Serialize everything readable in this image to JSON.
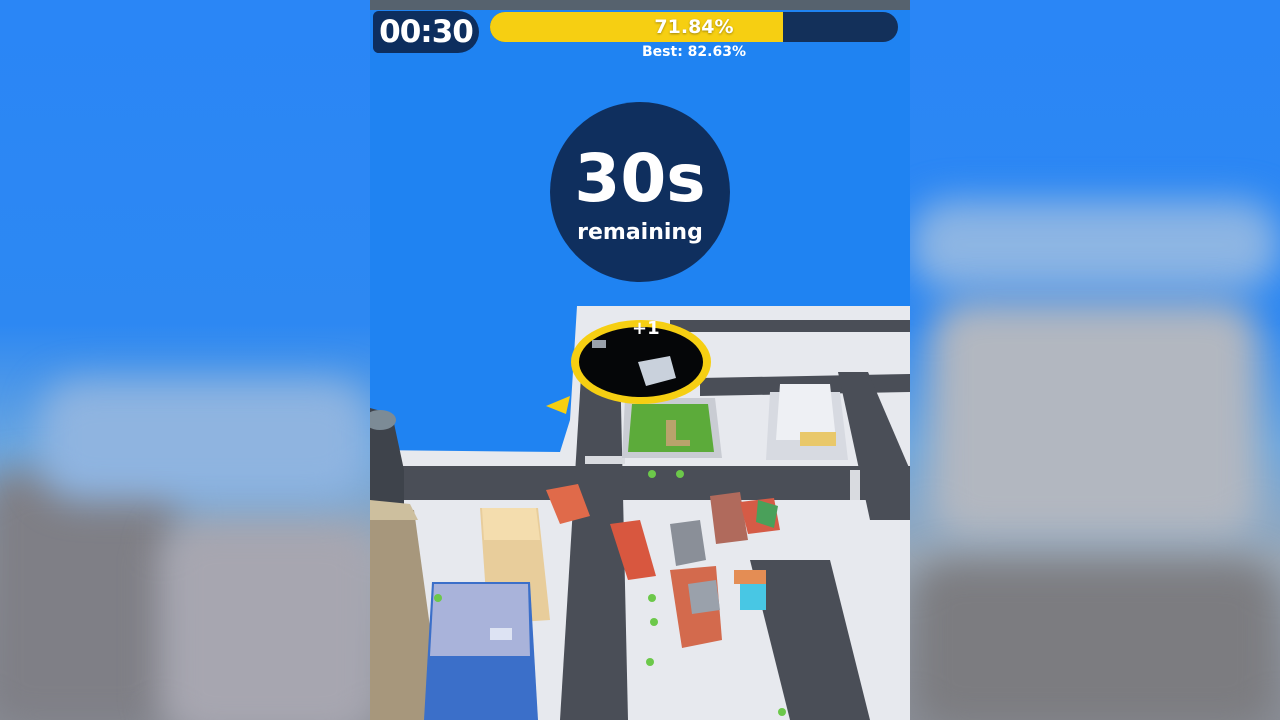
{
  "hud": {
    "timer": "00:30",
    "progress_text": "71.84%",
    "progress_fraction": 0.7184,
    "best_text": "Best: 82.63%"
  },
  "countdown": {
    "value": "30s",
    "label": "remaining"
  },
  "hole": {
    "score_popup": "+1"
  },
  "colors": {
    "sky": "#1f83f2",
    "hud_dark": "#0f2f5e",
    "progress_fill": "#f6cf12",
    "hole_ring": "#f6cf12",
    "grass": "#5cab3a",
    "road": "#4a4e57",
    "sidewalk": "#e7e9ee"
  },
  "icons": {
    "direction_arrow": "yellow-arrow-icon"
  }
}
